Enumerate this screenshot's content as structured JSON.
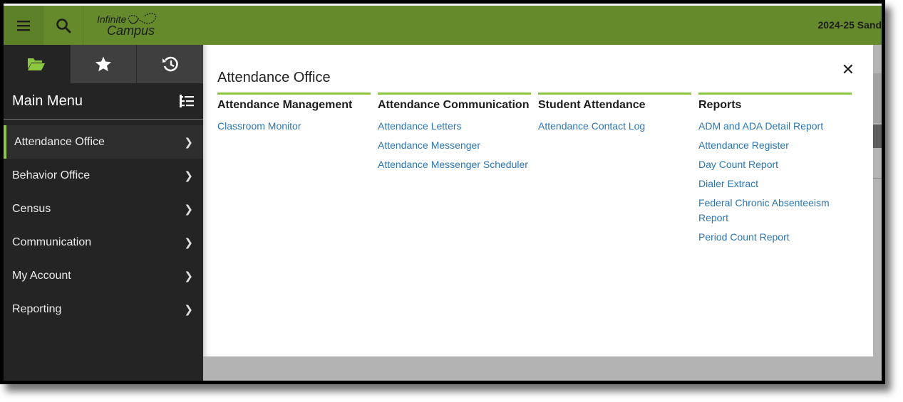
{
  "header": {
    "logo_line1": "Infinite",
    "logo_line2": "Campus",
    "year_label": "2024-25 Sand",
    "menu_icon": "hamburger-icon",
    "search_icon": "search-icon"
  },
  "sidebar": {
    "tabs": [
      {
        "icon": "folder-open-icon",
        "active": true
      },
      {
        "icon": "star-icon",
        "active": false
      },
      {
        "icon": "history-icon",
        "active": false
      }
    ],
    "title": "Main Menu",
    "title_icon": "tree-list-icon",
    "items": [
      {
        "label": "Attendance Office",
        "active": true
      },
      {
        "label": "Behavior Office",
        "active": false
      },
      {
        "label": "Census",
        "active": false
      },
      {
        "label": "Communication",
        "active": false
      },
      {
        "label": "My Account",
        "active": false
      },
      {
        "label": "Reporting",
        "active": false
      }
    ]
  },
  "panel": {
    "title": "Attendance Office",
    "close_icon": "close-icon",
    "columns": [
      {
        "heading": "Attendance Management",
        "links": [
          "Classroom Monitor"
        ]
      },
      {
        "heading": "Attendance Communication",
        "links": [
          "Attendance Letters",
          "Attendance Messenger",
          "Attendance Messenger Scheduler"
        ]
      },
      {
        "heading": "Student Attendance",
        "links": [
          "Attendance Contact Log"
        ]
      },
      {
        "heading": "Reports",
        "links": [
          "ADM and ADA Detail Report",
          "Attendance Register",
          "Day Count Report",
          "Dialer Extract",
          "Federal Chronic Absenteeism Report",
          "Period Count Report"
        ]
      }
    ]
  },
  "colors": {
    "header_green": "#648a2c",
    "accent_green": "#8dc63f",
    "link_blue": "#2a76b8",
    "sidebar_bg": "#242424"
  }
}
